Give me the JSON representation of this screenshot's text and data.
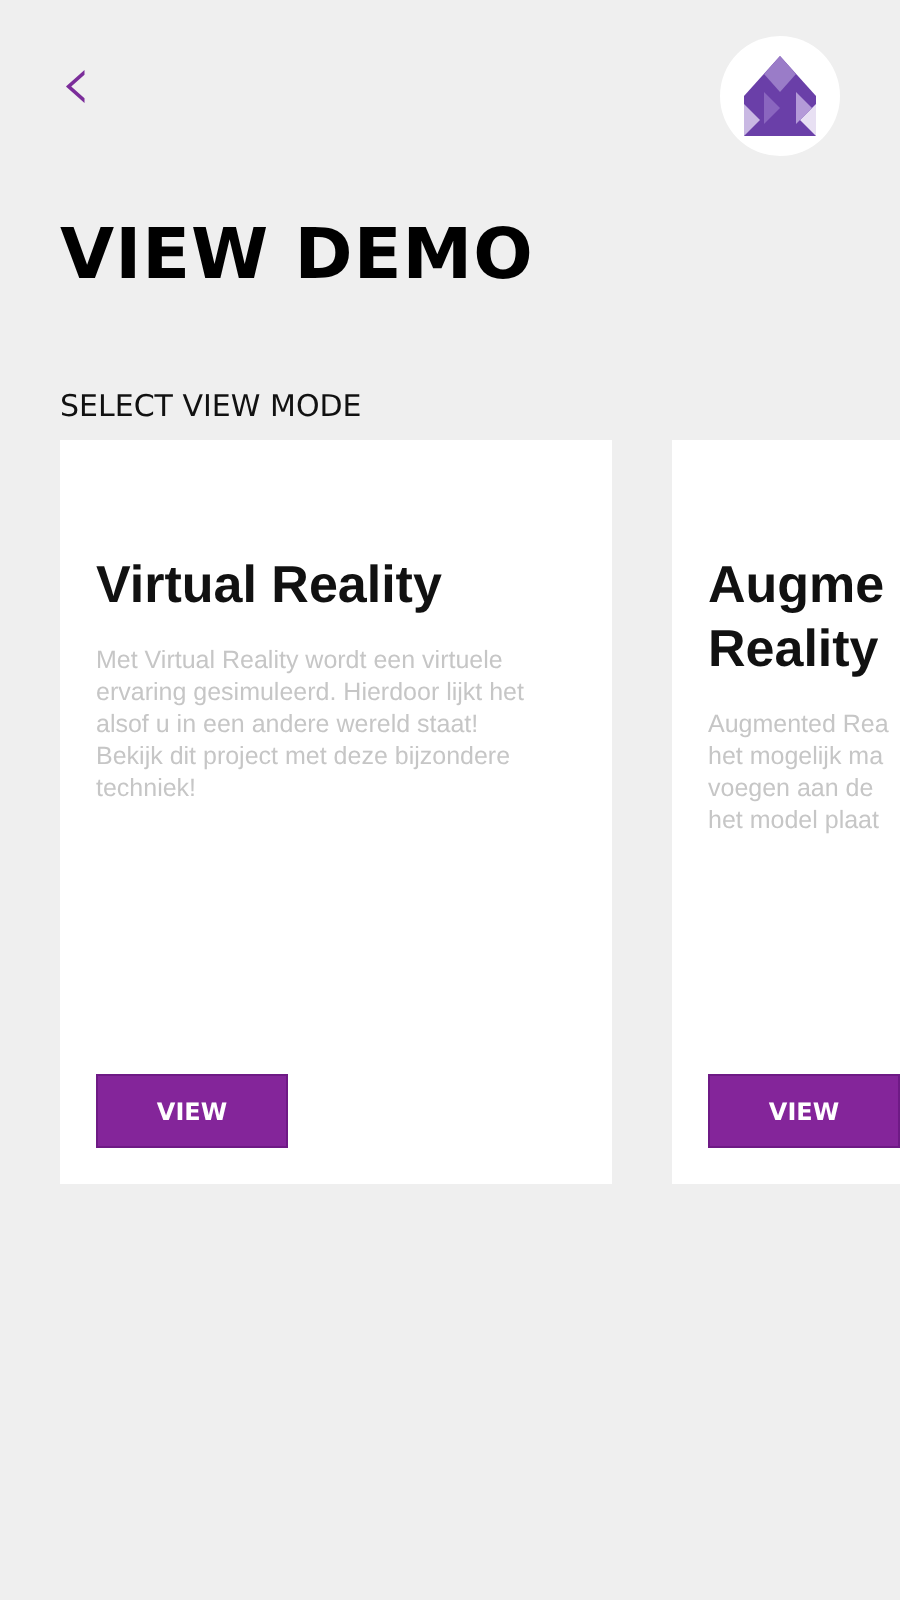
{
  "header": {
    "back": "‹"
  },
  "title": "VIEW DEMO",
  "section_label": "SELECT VIEW MODE",
  "cards": [
    {
      "title_lines": [
        "Virtual Reality"
      ],
      "description_lines": [
        "Met Virtual Reality wordt een virtuele",
        "ervaring gesimuleerd. Hierdoor lijkt het",
        "alsof u in een andere wereld staat!",
        "Bekijk dit project met deze bijzondere",
        "techniek!"
      ],
      "button": "VIEW"
    },
    {
      "title_lines": [
        "Augme",
        "Reality"
      ],
      "description_lines": [
        "Augmented Rea",
        "het mogelijk ma",
        "voegen aan de",
        "het model plaat"
      ],
      "button": "VIEW"
    }
  ]
}
